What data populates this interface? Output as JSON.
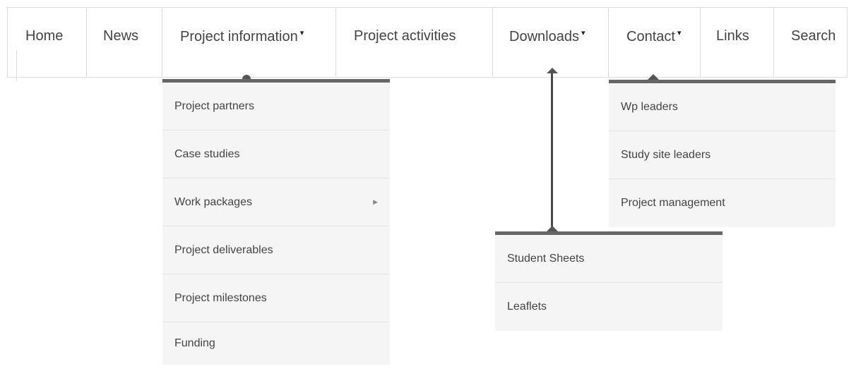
{
  "nav": {
    "items": [
      {
        "label": "Home",
        "caret": ""
      },
      {
        "label": "News",
        "caret": ""
      },
      {
        "label": "Project information",
        "caret": "▾"
      },
      {
        "label": "Project activities",
        "caret": ""
      },
      {
        "label": "Downloads",
        "caret": "▾"
      },
      {
        "label": "Contact",
        "caret": "▾"
      },
      {
        "label": "Links",
        "caret": ""
      },
      {
        "label": "Search",
        "caret": ""
      }
    ]
  },
  "dropdowns": {
    "project_information": {
      "items": [
        {
          "label": "Project partners"
        },
        {
          "label": "Case studies"
        },
        {
          "label": "Work packages",
          "submenu_icon": "▶"
        },
        {
          "label": "Project deliverables"
        },
        {
          "label": "Project milestones"
        },
        {
          "label": "Funding"
        }
      ]
    },
    "downloads": {
      "items": [
        {
          "label": "Student Sheets"
        },
        {
          "label": "Leaflets"
        }
      ]
    },
    "contact": {
      "items": [
        {
          "label": "Wp leaders"
        },
        {
          "label": "Study site leaders"
        },
        {
          "label": "Project management"
        }
      ]
    }
  },
  "colors": {
    "dropdown_bg": "#f5f5f5",
    "dropdown_bar": "#666666",
    "border": "#dedede",
    "text": "#444444"
  }
}
